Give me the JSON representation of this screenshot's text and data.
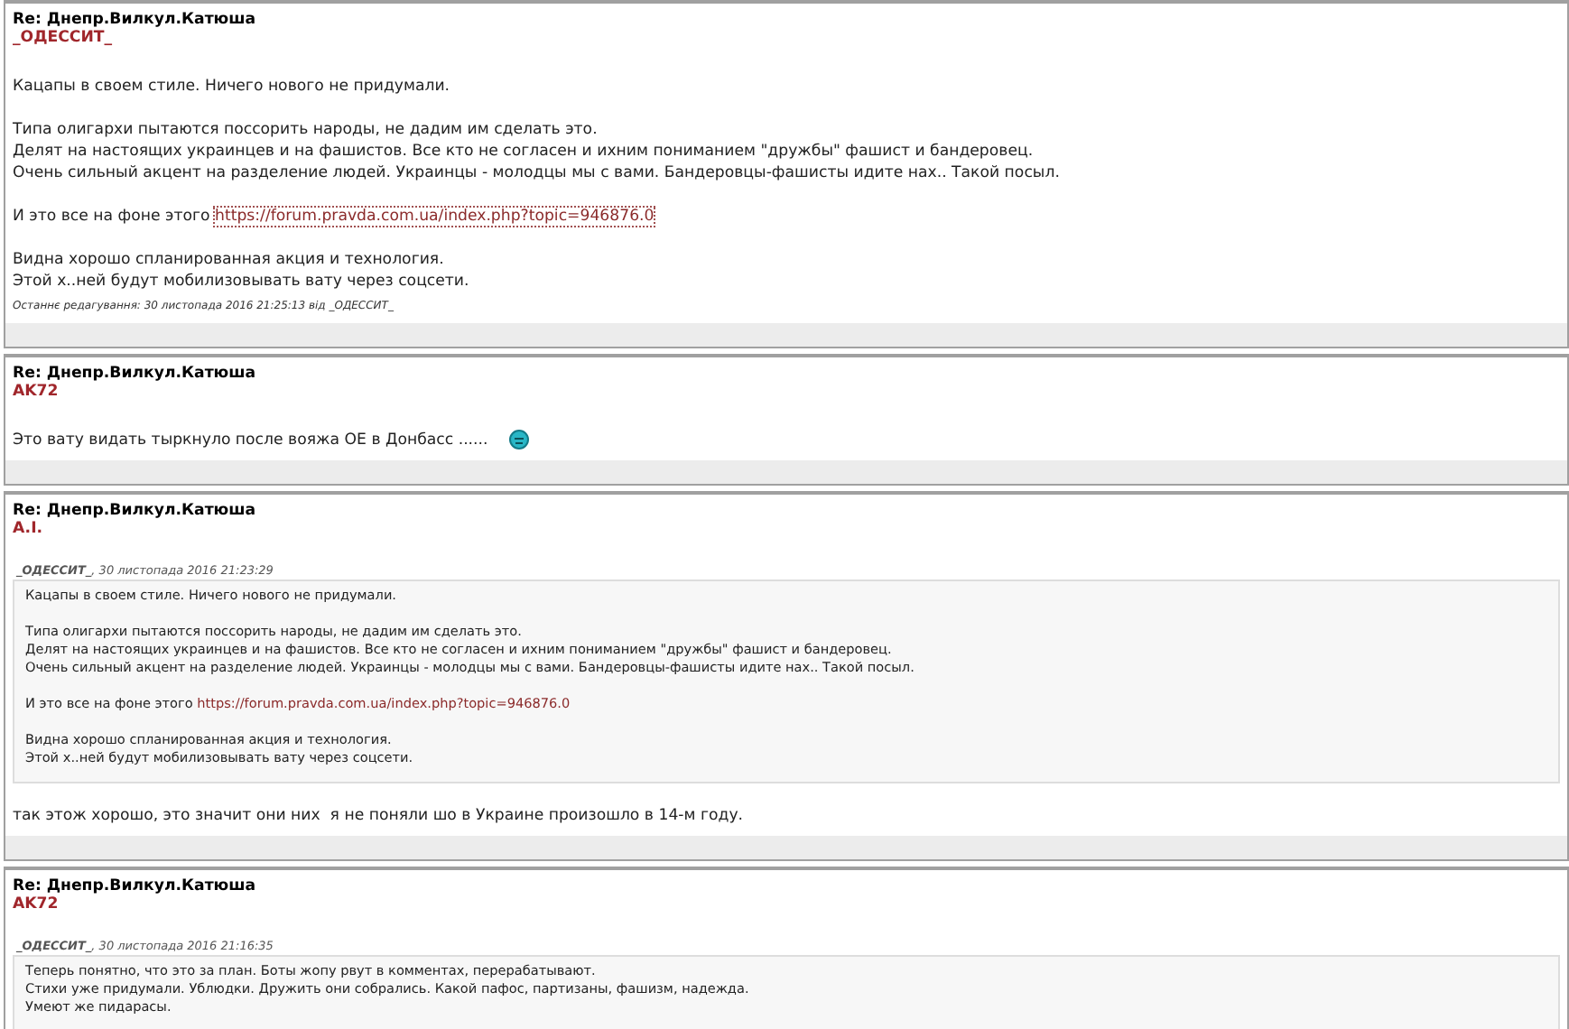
{
  "posts": [
    {
      "title": "Re: Днепр.Вилкул.Катюша",
      "author": "_ОДЕССИТ_",
      "blocks": [
        {
          "kind": "text",
          "lines": [
            "Кацапы в своем стиле. Ничего нового не придумали."
          ]
        },
        {
          "kind": "text",
          "lines": [
            "Типа олигархи пытаются поссорить народы, не дадим им сделать это.",
            "Делят на настоящих украинцев и на фашистов. Все кто не согласен и ихним пониманием \"дружбы\" фашист и бандеровец.",
            "Очень сильный акцент на разделение людей. Украинцы - молодцы мы с вами. Бандеровцы-фашисты идите нах.. Такой посыл."
          ]
        },
        {
          "kind": "link",
          "text": "И это все на фоне этого ",
          "url": "https://forum.pravda.com.ua/index.php?topic=946876.0",
          "focused": true
        },
        {
          "kind": "text",
          "lines": [
            "Видна хорошо спланированная акция и технология.",
            "Этой х..ней будут мобилизовывать вату через соцсети."
          ]
        }
      ],
      "edited": "Останнє редагування: 30 листопада 2016 21:25:13 від _ОДЕССИТ_"
    },
    {
      "title": "Re: Днепр.Вилкул.Катюша",
      "author": "AK72",
      "blocks": [
        {
          "kind": "text",
          "lines": [
            "Это вату видать тыркнуло после вояжа ОЕ в Донбасс ......"
          ],
          "emoticon": true
        }
      ]
    },
    {
      "title": "Re: Днепр.Вилкул.Катюша",
      "author": "A.I.",
      "quote": {
        "author": "_ОДЕССИТ_",
        "date": ", 30 листопада 2016 21:23:29",
        "blocks": [
          {
            "kind": "text",
            "lines": [
              "Кацапы в своем стиле. Ничего нового не придумали."
            ]
          },
          {
            "kind": "text",
            "lines": [
              "Типа олигархи пытаются поссорить народы, не дадим им сделать это.",
              "Делят на настоящих украинцев и на фашистов. Все кто не согласен и ихним пониманием \"дружбы\" фашист и бандеровец.",
              "Очень сильный акцент на разделение людей. Украинцы - молодцы мы с вами. Бандеровцы-фашисты идите нах.. Такой посыл."
            ]
          },
          {
            "kind": "link",
            "text": "И это все на фоне этого ",
            "url": "https://forum.pravda.com.ua/index.php?topic=946876.0",
            "focused": false
          },
          {
            "kind": "text",
            "lines": [
              "Видна хорошо спланированная акция и технология.",
              "Этой х..ней будут мобилизовывать вату через соцсети."
            ]
          }
        ]
      },
      "blocks": [
        {
          "kind": "text",
          "lines": [
            "так этож хорошо, это значит они них  я не поняли шо в Украине произошло в 14-м году."
          ]
        }
      ]
    },
    {
      "title": "Re: Днепр.Вилкул.Катюша",
      "author": "AK72",
      "quote": {
        "author": "_ОДЕССИТ_",
        "date": ", 30 листопада 2016 21:16:35",
        "blocks": [
          {
            "kind": "text",
            "lines": [
              "Теперь понятно, что это за план. Боты жопу рвут в комментах, перерабатывают.",
              "Стихи уже придумали. Ублюдки. Дружить они собрались. Какой пафос, партизаны, фашизм, надежда.",
              "Умеют же пидарасы."
            ]
          }
        ]
      }
    }
  ]
}
